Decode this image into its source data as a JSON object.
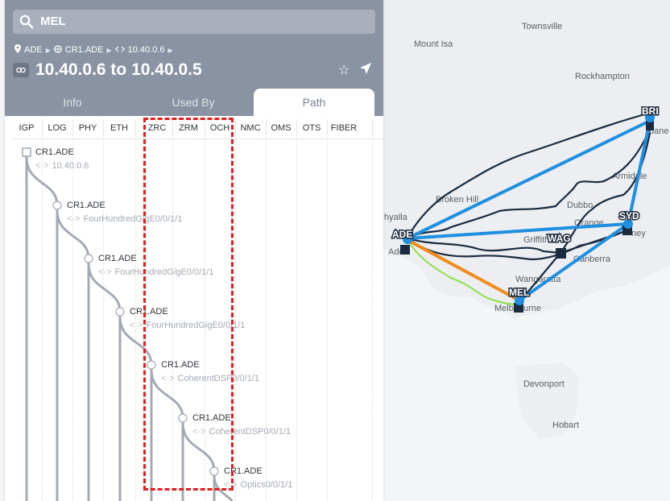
{
  "search": {
    "value": "MEL",
    "icon": "search-icon"
  },
  "breadcrumb": {
    "items": [
      {
        "label": "ADE",
        "icon": "map-pin-icon"
      },
      {
        "label": "CR1.ADE",
        "icon": "router-icon"
      },
      {
        "label": "10.40.0.6",
        "icon": "interface-icon"
      }
    ]
  },
  "title": "10.40.0.6 to 10.40.0.5",
  "tabs": [
    "Info",
    "Used By",
    "Path"
  ],
  "active_tab": "Path",
  "layers": [
    "IGP",
    "LOG",
    "PHY",
    "ETH",
    "ZRC",
    "ZRM",
    "OCH",
    "NMC",
    "OMS",
    "OTS",
    "FIBER"
  ],
  "path_nodes": [
    {
      "name": "CR1.ADE",
      "port": "10.40.0.6"
    },
    {
      "name": "CR1.ADE",
      "port": "FourHundredGigE0/0/1/1"
    },
    {
      "name": "CR1.ADE",
      "port": "FourHundredGigE0/0/1/1"
    },
    {
      "name": "CR1.ADE",
      "port": "FourHundredGigE0/0/1/1"
    },
    {
      "name": "CR1.ADE",
      "port": "CoherentDSP0/0/1/1"
    },
    {
      "name": "CR1.ADE",
      "port": "CoherentDSP0/0/1/1"
    },
    {
      "name": "CR1.ADE",
      "port": "Optics0/0/1/1"
    }
  ],
  "map": {
    "cities": [
      "Townsville",
      "Mount Isa",
      "Rockhampton",
      "Broken Hill",
      "Dubbo",
      "Armidale",
      "Orange",
      "Griffith",
      "Canberra",
      "Wangaratta",
      "Devonport",
      "Hobart",
      "Whyalla"
    ],
    "sites": [
      "BRI",
      "SYD",
      "ADE",
      "WAG",
      "MEL"
    ],
    "partial_labels": [
      "bane",
      "ney",
      "Ade",
      "Melb",
      "urne",
      "stle",
      "Ne",
      "hyalla"
    ],
    "colors": {
      "link_blue": "#1f8fe0",
      "fiber_dark": "#1a2b40",
      "link_orange": "#f08c1c",
      "link_green": "#8ee04a"
    }
  },
  "highlight_color": "#e02020"
}
